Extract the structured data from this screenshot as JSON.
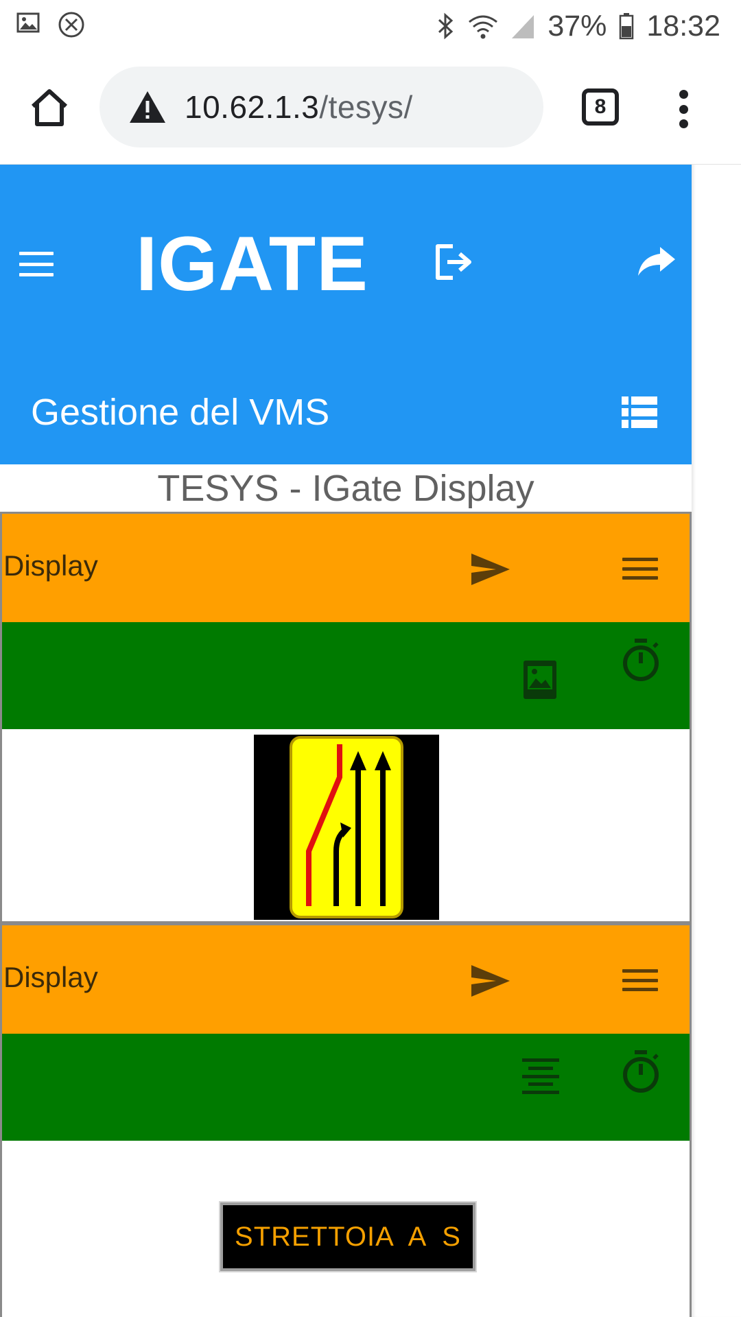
{
  "status_bar": {
    "battery_percent": "37%",
    "time": "18:32",
    "icons": [
      "image-notification-icon",
      "blocked-notification-icon",
      "bluetooth-icon",
      "wifi-icon",
      "cell-signal-icon",
      "battery-icon"
    ]
  },
  "browser": {
    "url_host": "10.62.1.3",
    "url_path": "/tesys/",
    "tab_count": "8",
    "icons": [
      "home-icon",
      "warning-icon",
      "tab-switcher-icon",
      "overflow-menu-icon"
    ]
  },
  "app": {
    "brand": "IGATE",
    "subtitle": "Gestione del VMS",
    "page_heading": "TESYS - IGate Display",
    "accent_color": "#2196f3",
    "header_color": "#ff9f00",
    "row_color": "#007a00"
  },
  "panels": [
    {
      "title": "Display",
      "content_type": "image",
      "row_icons": [
        "image-icon",
        "timer-icon"
      ]
    },
    {
      "title": "Display",
      "content_type": "text",
      "message": "STRETTOIA  A  S",
      "row_icons": [
        "align-center-icon",
        "timer-icon"
      ]
    }
  ]
}
